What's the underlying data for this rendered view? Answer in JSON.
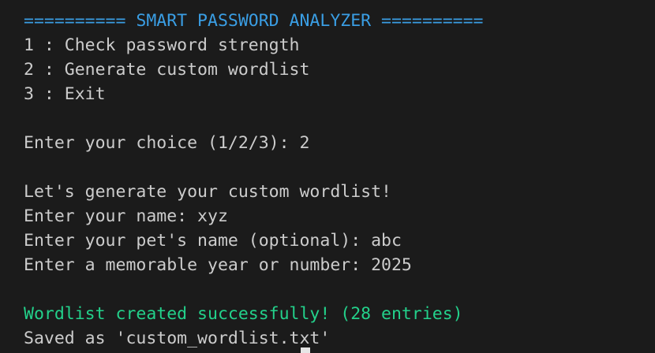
{
  "terminal": {
    "banner": "========== SMART PASSWORD ANALYZER ==========",
    "menu": [
      "1 : Check password strength",
      "2 : Generate custom wordlist",
      "3 : Exit"
    ],
    "choice_prompt": "Enter your choice (1/2/3): 2",
    "intro": "Let's generate your custom wordlist!",
    "name_prompt": "Enter your name: xyz",
    "pet_prompt": "Enter your pet's name (optional): abc",
    "year_prompt": "Enter a memorable year or number: 2025",
    "success_message": "Wordlist created successfully! (28 entries)",
    "saved_message": "Saved as 'custom_wordlist.txt'"
  },
  "colors": {
    "background": "#1b1b1b",
    "text": "#cccccc",
    "banner": "#3a9ee4",
    "success": "#23d18b"
  }
}
